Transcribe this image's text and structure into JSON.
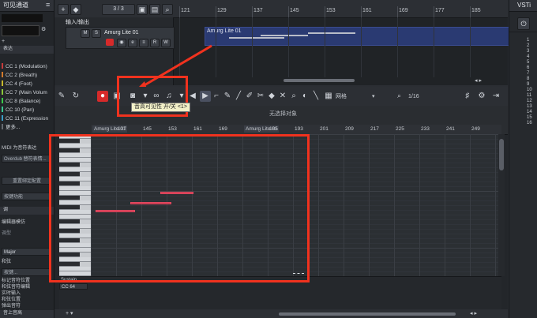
{
  "inspector": {
    "header": "可见通道",
    "input_output": "输入/输出",
    "section_label": "表达",
    "cc_items": [
      {
        "label": "CC 1  (Modulation)",
        "color": "#c83a3a"
      },
      {
        "label": "CC 2  (Breath)",
        "color": "#d27a2c"
      },
      {
        "label": "CC 4  (Foot)",
        "color": "#c8b82c"
      },
      {
        "label": "CC 7  (Main Volum",
        "color": "#8cc83a"
      },
      {
        "label": "CC 8  (Balance)",
        "color": "#3ac84a"
      },
      {
        "label": "CC 10  (Pan)",
        "color": "#3ac890"
      },
      {
        "label": "CC 11  (Expression",
        "color": "#3a9ec8"
      },
      {
        "label": "更多...",
        "color": "#666a70"
      }
    ],
    "midi_to_expression": "MIDI 为音符表达",
    "overdub_label": "Overdub 替符表情...",
    "reset_button": "重置绑定配置",
    "function_label": "按键功能",
    "scale_section": "调",
    "scale_editor": "编辑器模仿",
    "scale_type": "调型",
    "scale_value": "Major",
    "chord_label": "和弦",
    "chord_value": "按键...",
    "items_bottom": [
      "标记音符位置",
      "和弦音符编辑",
      "实时输入",
      "和弦位置",
      "弹出音符"
    ],
    "bottom_label": "音上音高"
  },
  "arrange": {
    "counter": "3 / 3",
    "track_name": "Amurg Lite 01",
    "track_buttons": [
      "M",
      "S",
      "R",
      "W"
    ],
    "part_label": "Amurg Lite 01",
    "ruler": [
      "121",
      "129",
      "137",
      "145",
      "153",
      "161",
      "169",
      "177",
      "185"
    ]
  },
  "editor": {
    "tooltip": "音高可见性 开/关  <1>",
    "grid_label": "网格",
    "quantize_value": "1/16",
    "status_text": "无选择对象",
    "ruler": [
      "Amurg Lite 01",
      "137",
      "145",
      "153",
      "161",
      "169",
      "Amurg Lite 01",
      "185",
      "193",
      "201",
      "209",
      "217",
      "225",
      "233",
      "241",
      "249"
    ],
    "lane_label": "Sustain",
    "lane_value": "CC 64"
  },
  "right_panel": {
    "title": "VSTi",
    "numbers": [
      "1",
      "2",
      "3",
      "4",
      "5",
      "6",
      "7",
      "8",
      "9",
      "10",
      "11",
      "12",
      "13",
      "14",
      "15",
      "16"
    ]
  },
  "colors": {
    "annotation_red": "#f0321e",
    "note_red": "#c13a4d",
    "record_red": "#d62a2a",
    "part_blue": "#2a3a72"
  }
}
